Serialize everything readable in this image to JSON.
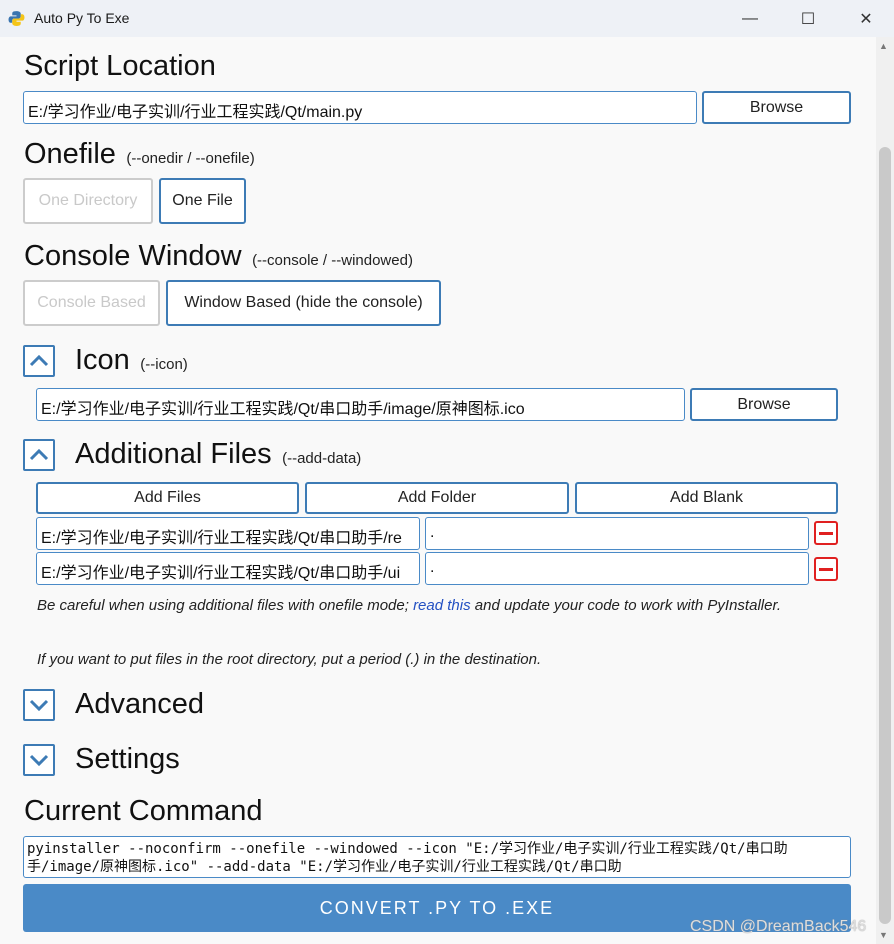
{
  "window": {
    "title": "Auto Py To Exe",
    "minimize": "—",
    "maximize": "☐",
    "close": "✕"
  },
  "script_location": {
    "heading": "Script Location",
    "value": "E:/学习作业/电子实训/行业工程实践/Qt/main.py",
    "browse": "Browse"
  },
  "onefile": {
    "heading": "Onefile",
    "hint": "(--onedir / --onefile)",
    "option_dir": "One Directory",
    "option_file": "One File"
  },
  "console": {
    "heading": "Console Window",
    "hint": "(--console / --windowed)",
    "option_console": "Console Based",
    "option_window": "Window Based (hide the console)"
  },
  "icon": {
    "heading": "Icon",
    "hint": "(--icon)",
    "value": "E:/学习作业/电子实训/行业工程实践/Qt/串口助手/image/原神图标.ico",
    "browse": "Browse"
  },
  "additional_files": {
    "heading": "Additional Files",
    "hint": "(--add-data)",
    "add_files": "Add Files",
    "add_folder": "Add Folder",
    "add_blank": "Add Blank",
    "rows": [
      {
        "source": "E:/学习作业/电子实训/行业工程实践/Qt/串口助手/re",
        "dest": "."
      },
      {
        "source": "E:/学习作业/电子实训/行业工程实践/Qt/串口助手/ui",
        "dest": "."
      }
    ],
    "note1_a": "Be careful when using additional files with onefile mode; ",
    "note1_link": "read this",
    "note1_b": " and update your code to work with PyInstaller.",
    "note2": "If you want to put files in the root directory, put a period (.) in the destination."
  },
  "advanced": {
    "heading": "Advanced"
  },
  "settings": {
    "heading": "Settings"
  },
  "current_command": {
    "heading": "Current Command",
    "text": "pyinstaller --noconfirm --onefile --windowed --icon \"E:/学习作业/电子实训/行业工程实践/Qt/串口助手/image/原神图标.ico\" --add-data \"E:/学习作业/电子实训/行业工程实践/Qt/串口助"
  },
  "convert_button": "CONVERT .PY TO .EXE",
  "watermark": "CSDN @DreamBack546",
  "colors": {
    "accent": "#4a8ac7",
    "border_accent": "#3d7bb5",
    "danger": "#e02020",
    "link": "#2350c2"
  }
}
